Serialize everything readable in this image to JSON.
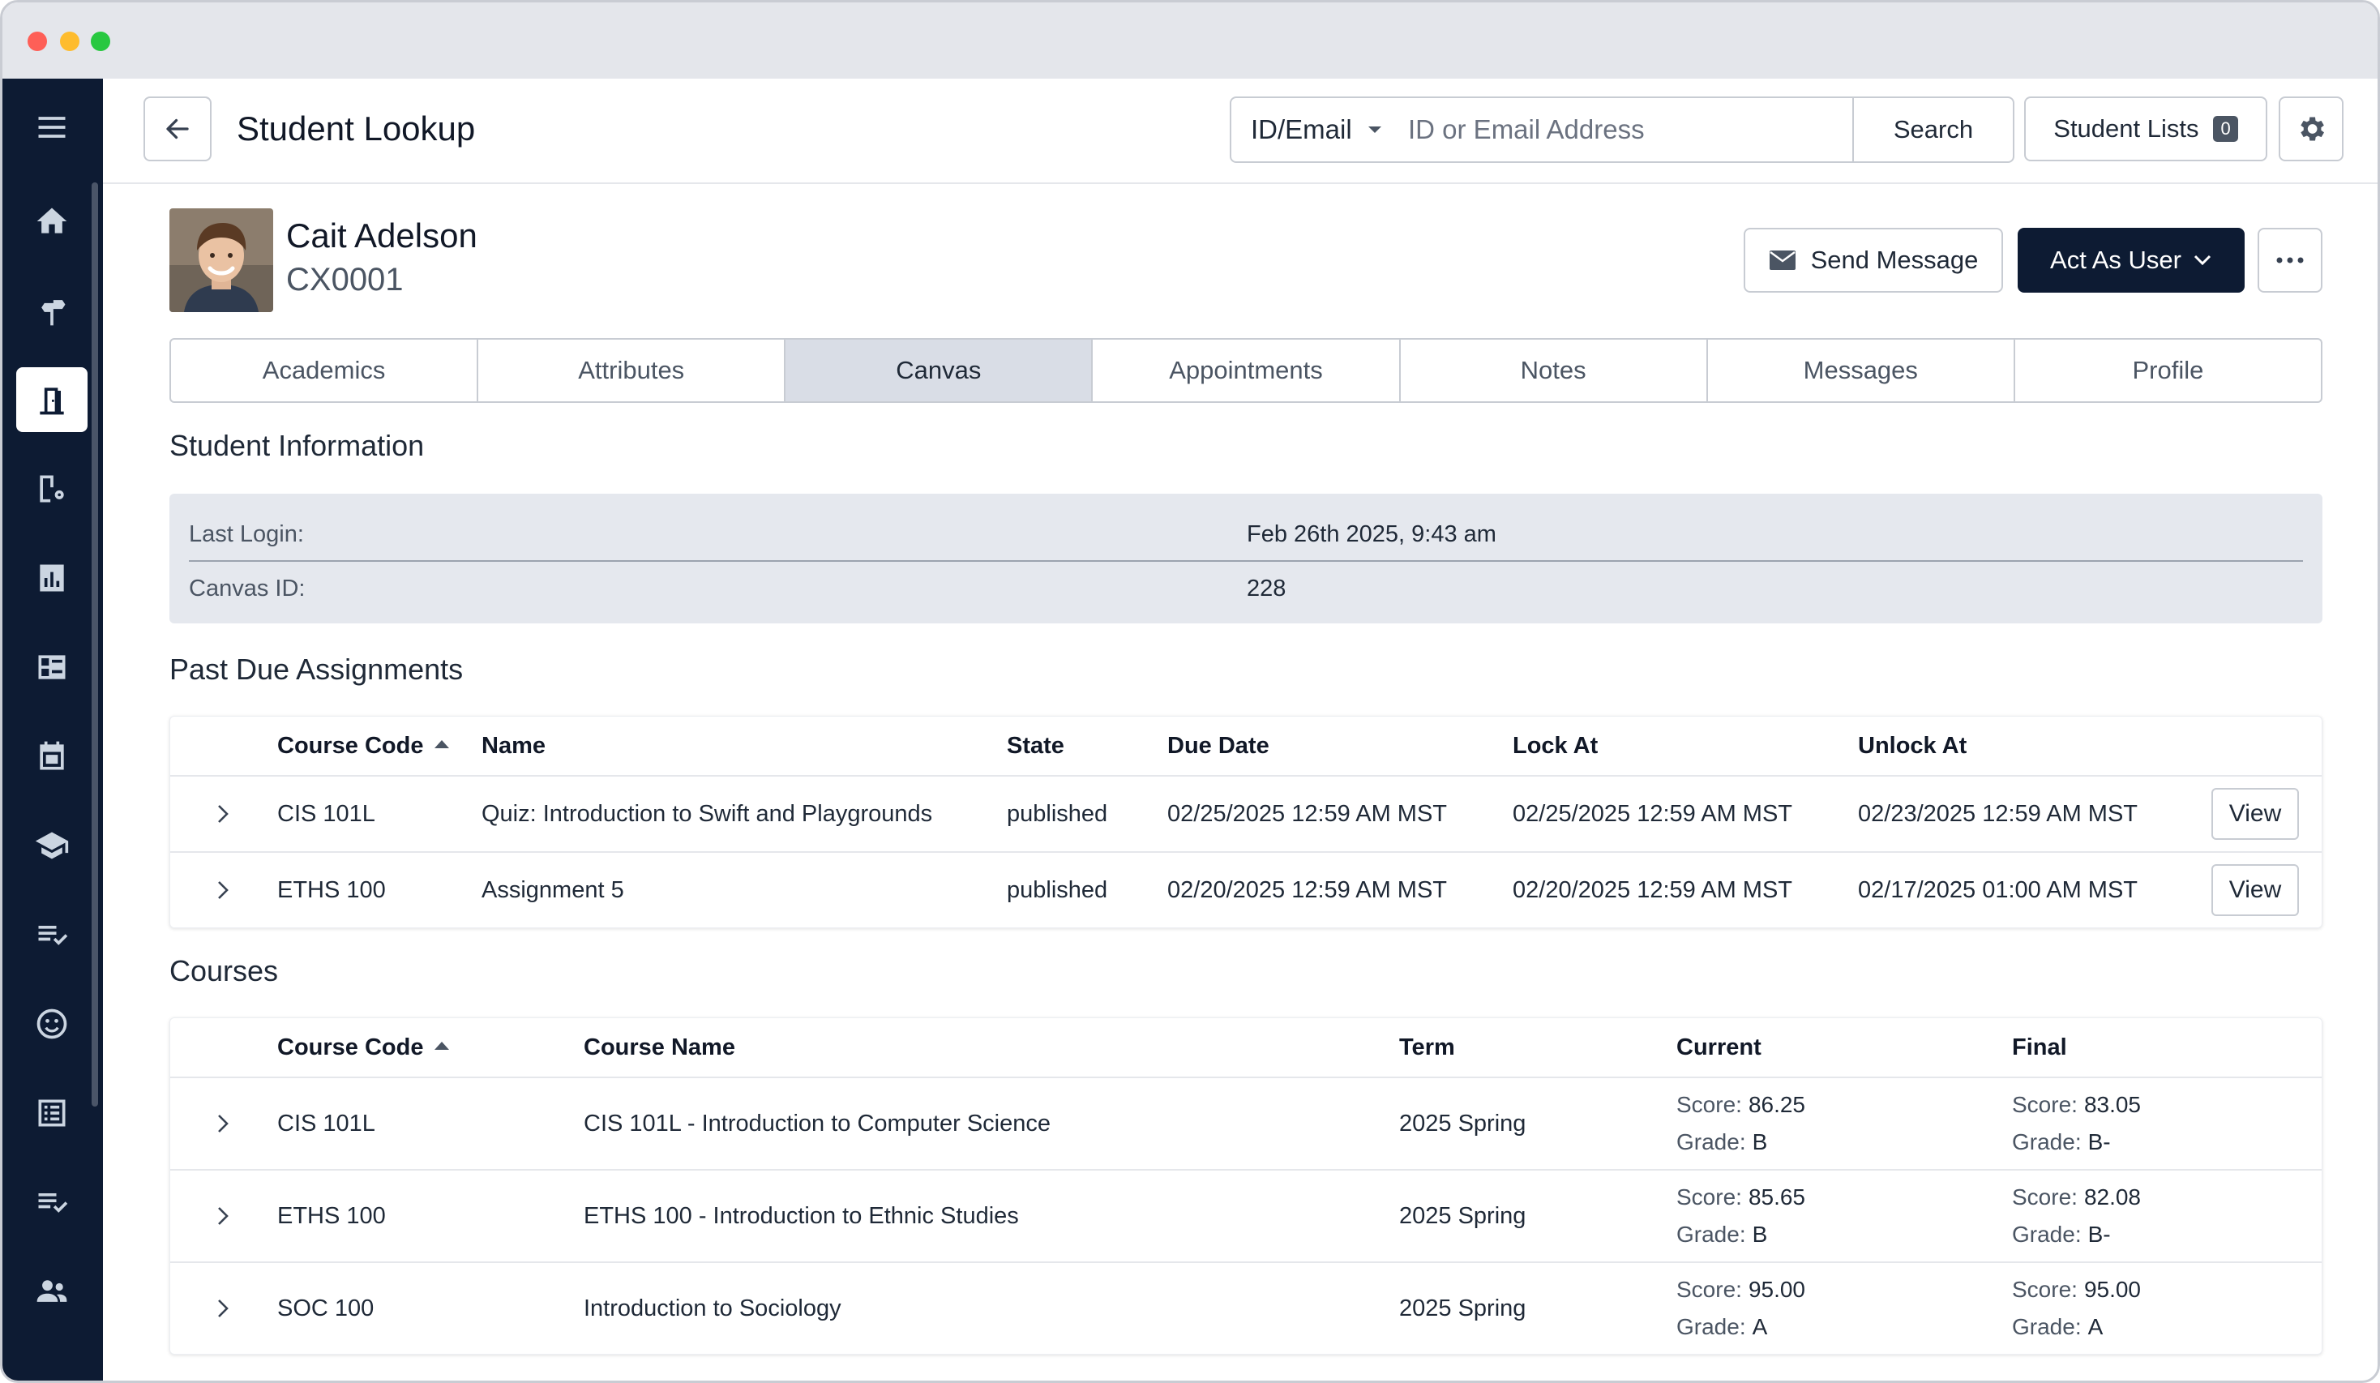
{
  "header": {
    "title": "Student Lookup",
    "search_type": "ID/Email",
    "search_placeholder": "ID or Email Address",
    "search_label": "Search",
    "student_lists_label": "Student Lists",
    "student_lists_count": "0"
  },
  "sidebar": {
    "items": [
      {
        "icon": "menu-icon"
      },
      {
        "icon": "home-icon"
      },
      {
        "icon": "signpost-icon"
      },
      {
        "icon": "door-icon",
        "active": true
      },
      {
        "icon": "building-settings-icon"
      },
      {
        "icon": "bar-chart-icon"
      },
      {
        "icon": "dashboard-icon"
      },
      {
        "icon": "calendar-icon"
      },
      {
        "icon": "graduation-cap-icon"
      },
      {
        "icon": "checklist-icon"
      },
      {
        "icon": "smiley-icon"
      },
      {
        "icon": "list-icon"
      },
      {
        "icon": "checklist-icon"
      },
      {
        "icon": "people-icon"
      }
    ]
  },
  "student": {
    "name": "Cait Adelson",
    "id": "CX0001",
    "send_message_label": "Send Message",
    "act_as_user_label": "Act As User"
  },
  "tabs": [
    {
      "label": "Academics"
    },
    {
      "label": "Attributes"
    },
    {
      "label": "Canvas",
      "active": true
    },
    {
      "label": "Appointments"
    },
    {
      "label": "Notes"
    },
    {
      "label": "Messages"
    },
    {
      "label": "Profile"
    }
  ],
  "student_info": {
    "title": "Student Information",
    "rows": [
      {
        "label": "Last Login:",
        "value": "Feb 26th 2025, 9:43 am"
      },
      {
        "label": "Canvas ID:",
        "value": "228"
      }
    ]
  },
  "past_due": {
    "title": "Past Due Assignments",
    "columns": [
      "Course Code",
      "Name",
      "State",
      "Due Date",
      "Lock At",
      "Unlock At"
    ],
    "view_label": "View",
    "rows": [
      {
        "course_code": "CIS 101L",
        "name": "Quiz: Introduction to Swift and Playgrounds",
        "state": "published",
        "due": "02/25/2025 12:59 AM MST",
        "lock": "02/25/2025 12:59 AM MST",
        "unlock": "02/23/2025 12:59 AM MST"
      },
      {
        "course_code": "ETHS 100",
        "name": "Assignment 5",
        "state": "published",
        "due": "02/20/2025 12:59 AM MST",
        "lock": "02/20/2025 12:59 AM MST",
        "unlock": "02/17/2025 01:00 AM MST"
      }
    ]
  },
  "courses": {
    "title": "Courses",
    "columns": [
      "Course Code",
      "Course Name",
      "Term",
      "Current",
      "Final"
    ],
    "score_label": "Score:",
    "grade_label": "Grade:",
    "rows": [
      {
        "course_code": "CIS 101L",
        "course_name": "CIS 101L - Introduction to Computer Science",
        "term": "2025 Spring",
        "current_score": "86.25",
        "current_grade": "B",
        "final_score": "83.05",
        "final_grade": "B-"
      },
      {
        "course_code": "ETHS 100",
        "course_name": "ETHS 100 - Introduction to Ethnic Studies",
        "term": "2025 Spring",
        "current_score": "85.65",
        "current_grade": "B",
        "final_score": "82.08",
        "final_grade": "B-"
      },
      {
        "course_code": "SOC 100",
        "course_name": "Introduction to Sociology",
        "term": "2025 Spring",
        "current_score": "95.00",
        "current_grade": "A",
        "final_score": "95.00",
        "final_grade": "A"
      }
    ]
  }
}
